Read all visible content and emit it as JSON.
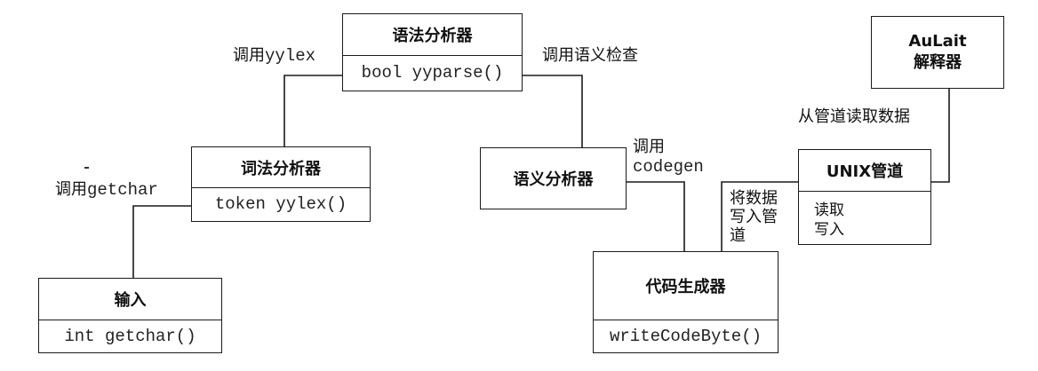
{
  "boxes": {
    "parser": {
      "title": "语法分析器",
      "method": "bool yyparse()"
    },
    "lexer": {
      "title": "词法分析器",
      "method": "token yylex()"
    },
    "input": {
      "title": "输入",
      "method": "int getchar()"
    },
    "semantic": {
      "title": "语义分析器"
    },
    "codegen": {
      "title": "代码生成器",
      "method": "writeCodeByte()"
    },
    "pipe": {
      "title": "UNIX管道",
      "ops": [
        "读取",
        "写入"
      ]
    },
    "aulait": {
      "line1": "AuLait",
      "line2": "解释器"
    }
  },
  "edges": {
    "parser_to_lexer": {
      "prefix": "调用",
      "code": "yylex"
    },
    "parser_to_semantic": {
      "text": "调用语义检查"
    },
    "lexer_to_input": {
      "prefix": "调用",
      "code": "getchar"
    },
    "semantic_to_codegen": {
      "line1": "调用",
      "line2": "codegen"
    },
    "codegen_to_pipe": {
      "lines": [
        "将数据",
        "写入管",
        "道"
      ]
    },
    "pipe_to_aulait": {
      "text": "从管道读取数据"
    }
  }
}
